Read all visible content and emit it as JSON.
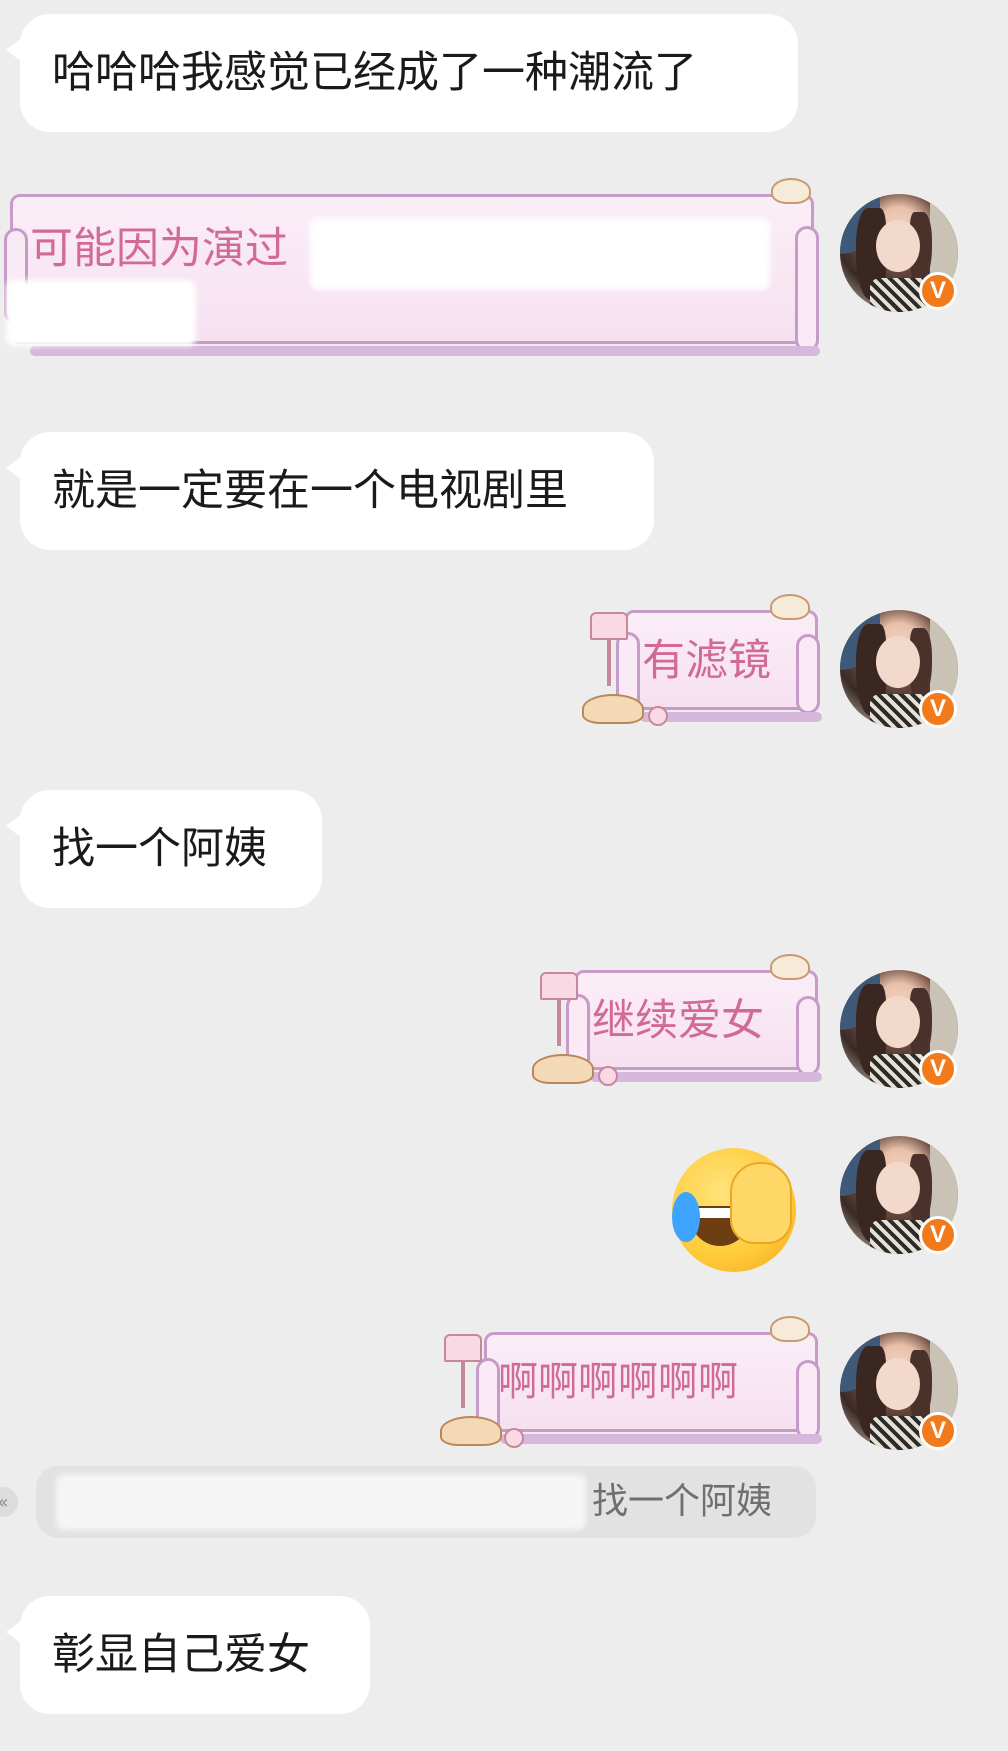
{
  "messages": [
    {
      "id": "m1",
      "side": "left",
      "text": "哈哈哈我感觉已经成了一种潮流了"
    },
    {
      "id": "m2",
      "side": "right",
      "text": "可能因为演过"
    },
    {
      "id": "m3",
      "side": "left",
      "text": "就是一定要在一个电视剧里"
    },
    {
      "id": "m4",
      "side": "right",
      "text": "有滤镜"
    },
    {
      "id": "m5",
      "side": "left",
      "text": "找一个阿姨"
    },
    {
      "id": "m6",
      "side": "right",
      "text": "继续爱女"
    },
    {
      "id": "m7",
      "side": "right",
      "emoji": "facepalm-laugh-cry-emoji"
    },
    {
      "id": "m8",
      "side": "right",
      "text": "啊啊啊啊啊啊"
    },
    {
      "id": "m9",
      "side": "left",
      "text": "彰显自己爱女"
    }
  ],
  "quote": {
    "text": "找一个阿姨"
  },
  "avatar": {
    "badge": "V",
    "badge_color": "#f27a1a"
  },
  "colors": {
    "background": "#ededed",
    "bubble_in": "#ffffff",
    "scroll_text": "#d26b94",
    "scroll_border": "#c79bc9"
  }
}
